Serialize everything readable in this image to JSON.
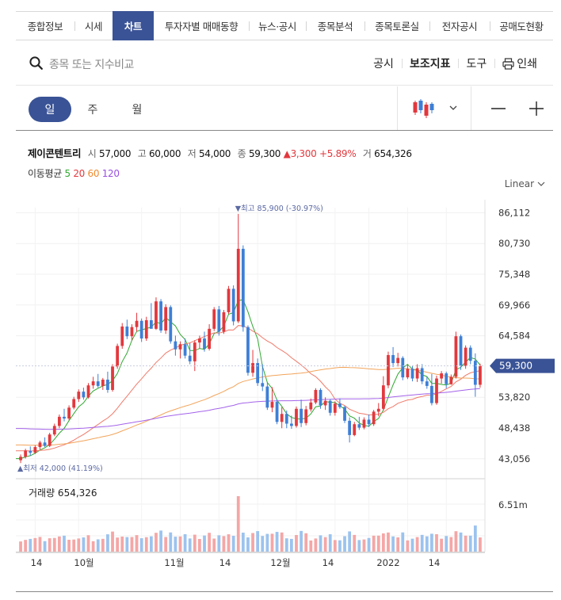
{
  "tabs": [
    {
      "label": "종합정보",
      "active": false
    },
    {
      "label": "시세",
      "active": false
    },
    {
      "label": "차트",
      "active": true
    },
    {
      "label": "투자자별 매매동향",
      "active": false
    },
    {
      "label": "뉴스·공시",
      "active": false
    },
    {
      "label": "종목분석",
      "active": false
    },
    {
      "label": "종목토론실",
      "active": false
    },
    {
      "label": "전자공시",
      "active": false
    },
    {
      "label": "공매도현황",
      "active": false
    }
  ],
  "search": {
    "placeholder": "종목 또는 지수비교"
  },
  "tools": {
    "disclosure": "공시",
    "indicators": "보조지표",
    "tools": "도구",
    "print": "인쇄"
  },
  "periods": {
    "day": "일",
    "week": "주",
    "month": "월"
  },
  "stock": {
    "name": "제이콘텐트리",
    "open_label": "시",
    "open": "57,000",
    "high_label": "고",
    "high": "60,000",
    "low_label": "저",
    "low": "54,000",
    "close_label": "종",
    "close": "59,300",
    "change": "▲3,300",
    "change_pct": "+5.89%",
    "volume_label": "거",
    "volume": "654,326"
  },
  "ma_legend": {
    "label": "이동평균",
    "p5": "5",
    "p20": "20",
    "p60": "60",
    "p120": "120"
  },
  "scale": {
    "label": "Linear"
  },
  "colors": {
    "up": "#e2383d",
    "down": "#3e7fd6",
    "accent": "#3a5396",
    "ma5": "#31a831",
    "ma20": "#f07a6a",
    "ma60": "#f2a45a",
    "ma120": "#a463ea"
  },
  "chart_data": {
    "type": "candlestick",
    "price_axis": {
      "ticks": [
        "86,112",
        "80,730",
        "75,348",
        "69,966",
        "64,584",
        "53,820",
        "48,438",
        "43,056"
      ],
      "range": [
        41500,
        87000
      ]
    },
    "current_price_label": "59,300",
    "high_marker": "▼최고 85,900 (-30.97%)",
    "low_marker": "▲최저 42,000 (41.19%)",
    "volume_label": "거래량 654,326",
    "volume_max_label": "6.51m",
    "x_labels": [
      "14",
      "10월",
      "11월",
      "14",
      "12월",
      "14",
      "2022",
      "14"
    ],
    "candles": [
      [
        42800,
        43800,
        42300,
        43400
      ],
      [
        43400,
        44800,
        43100,
        44500
      ],
      [
        44400,
        45200,
        43600,
        44100
      ],
      [
        44100,
        45400,
        43900,
        45100
      ],
      [
        45100,
        46200,
        44700,
        45900
      ],
      [
        45900,
        46800,
        45100,
        45300
      ],
      [
        45300,
        47600,
        45100,
        47300
      ],
      [
        47300,
        49200,
        47000,
        48800
      ],
      [
        48800,
        50800,
        48400,
        50400
      ],
      [
        50400,
        51800,
        49600,
        50100
      ],
      [
        50100,
        52400,
        49800,
        52000
      ],
      [
        52000,
        53900,
        51700,
        53500
      ],
      [
        53500,
        55200,
        53000,
        54800
      ],
      [
        54800,
        55500,
        53400,
        53800
      ],
      [
        53800,
        56300,
        53600,
        55900
      ],
      [
        55900,
        57400,
        55300,
        56600
      ],
      [
        56600,
        57900,
        55500,
        55800
      ],
      [
        55800,
        57200,
        55100,
        56900
      ],
      [
        56900,
        58300,
        54600,
        55100
      ],
      [
        55100,
        59600,
        54800,
        59200
      ],
      [
        59200,
        63200,
        58800,
        62800
      ],
      [
        62800,
        66800,
        62300,
        66200
      ],
      [
        66200,
        67400,
        64000,
        64500
      ],
      [
        64500,
        66600,
        63800,
        66100
      ],
      [
        66100,
        68600,
        65300,
        67200
      ],
      [
        67200,
        67600,
        63500,
        64100
      ],
      [
        64100,
        67900,
        63700,
        67300
      ],
      [
        67300,
        70300,
        66400,
        65800
      ],
      [
        65800,
        71300,
        65600,
        70600
      ],
      [
        70600,
        71000,
        65100,
        65500
      ],
      [
        65500,
        70100,
        64900,
        69600
      ],
      [
        69600,
        69900,
        63200,
        63600
      ],
      [
        63600,
        64600,
        61100,
        62200
      ],
      [
        62200,
        63600,
        60600,
        63100
      ],
      [
        63100,
        64100,
        60600,
        61100
      ],
      [
        61100,
        63300,
        59600,
        60100
      ],
      [
        60100,
        63800,
        58400,
        63400
      ],
      [
        63400,
        64600,
        62300,
        64100
      ],
      [
        64100,
        65300,
        61800,
        62300
      ],
      [
        62300,
        66600,
        62000,
        65800
      ],
      [
        65800,
        69600,
        65400,
        69200
      ],
      [
        69200,
        69800,
        64600,
        65300
      ],
      [
        65300,
        69100,
        64900,
        68700
      ],
      [
        68700,
        73300,
        68400,
        72800
      ],
      [
        72800,
        73400,
        66400,
        67100
      ],
      [
        67100,
        85900,
        66800,
        79800
      ],
      [
        79800,
        80400,
        65300,
        66100
      ],
      [
        66100,
        66400,
        57600,
        58100
      ],
      [
        58100,
        62100,
        57400,
        59800
      ],
      [
        59800,
        60600,
        55800,
        56300
      ],
      [
        56300,
        59600,
        54900,
        55700
      ],
      [
        55700,
        56400,
        51600,
        52000
      ],
      [
        52000,
        55600,
        51200,
        53000
      ],
      [
        53000,
        53500,
        49100,
        49500
      ],
      [
        49500,
        52100,
        48400,
        50900
      ],
      [
        50900,
        51500,
        48400,
        49200
      ],
      [
        49200,
        50600,
        48300,
        48800
      ],
      [
        48800,
        52200,
        48500,
        51800
      ],
      [
        51800,
        53400,
        48600,
        49300
      ],
      [
        49300,
        52300,
        48900,
        51700
      ],
      [
        51700,
        53600,
        51300,
        52900
      ],
      [
        52900,
        55400,
        52600,
        55100
      ],
      [
        55100,
        55400,
        51800,
        52400
      ],
      [
        52400,
        53800,
        51600,
        53200
      ],
      [
        53200,
        53500,
        50600,
        51100
      ],
      [
        51100,
        53100,
        50600,
        52700
      ],
      [
        52700,
        53600,
        51800,
        52100
      ],
      [
        52100,
        52300,
        49300,
        49700
      ],
      [
        49700,
        50300,
        45900,
        47200
      ],
      [
        47200,
        49500,
        47000,
        49100
      ],
      [
        49100,
        50400,
        48100,
        48500
      ],
      [
        48500,
        50300,
        48200,
        49900
      ],
      [
        49900,
        50800,
        48600,
        49100
      ],
      [
        49100,
        51600,
        48800,
        51300
      ],
      [
        51300,
        52800,
        50500,
        51800
      ],
      [
        51800,
        57500,
        51500,
        55900
      ],
      [
        55900,
        61800,
        55400,
        61200
      ],
      [
        61200,
        62600,
        59100,
        59800
      ],
      [
        59800,
        61600,
        59200,
        60700
      ],
      [
        60700,
        61000,
        56800,
        57300
      ],
      [
        57300,
        59600,
        57000,
        58800
      ],
      [
        58800,
        59400,
        56600,
        57100
      ],
      [
        57100,
        59600,
        56500,
        58900
      ],
      [
        58900,
        59600,
        56100,
        56600
      ],
      [
        56600,
        57400,
        55300,
        55800
      ],
      [
        55800,
        57900,
        52400,
        52800
      ],
      [
        52800,
        57600,
        52500,
        57100
      ],
      [
        57100,
        58400,
        56200,
        58000
      ],
      [
        58000,
        58300,
        55400,
        56100
      ],
      [
        56100,
        57800,
        56000,
        57400
      ],
      [
        57400,
        65300,
        57100,
        64500
      ],
      [
        64500,
        64800,
        58600,
        59300
      ],
      [
        59300,
        62900,
        58800,
        62500
      ],
      [
        62500,
        62900,
        59600,
        60200
      ],
      [
        60200,
        61500,
        53900,
        56000
      ],
      [
        56000,
        59700,
        55500,
        59300
      ]
    ]
  }
}
